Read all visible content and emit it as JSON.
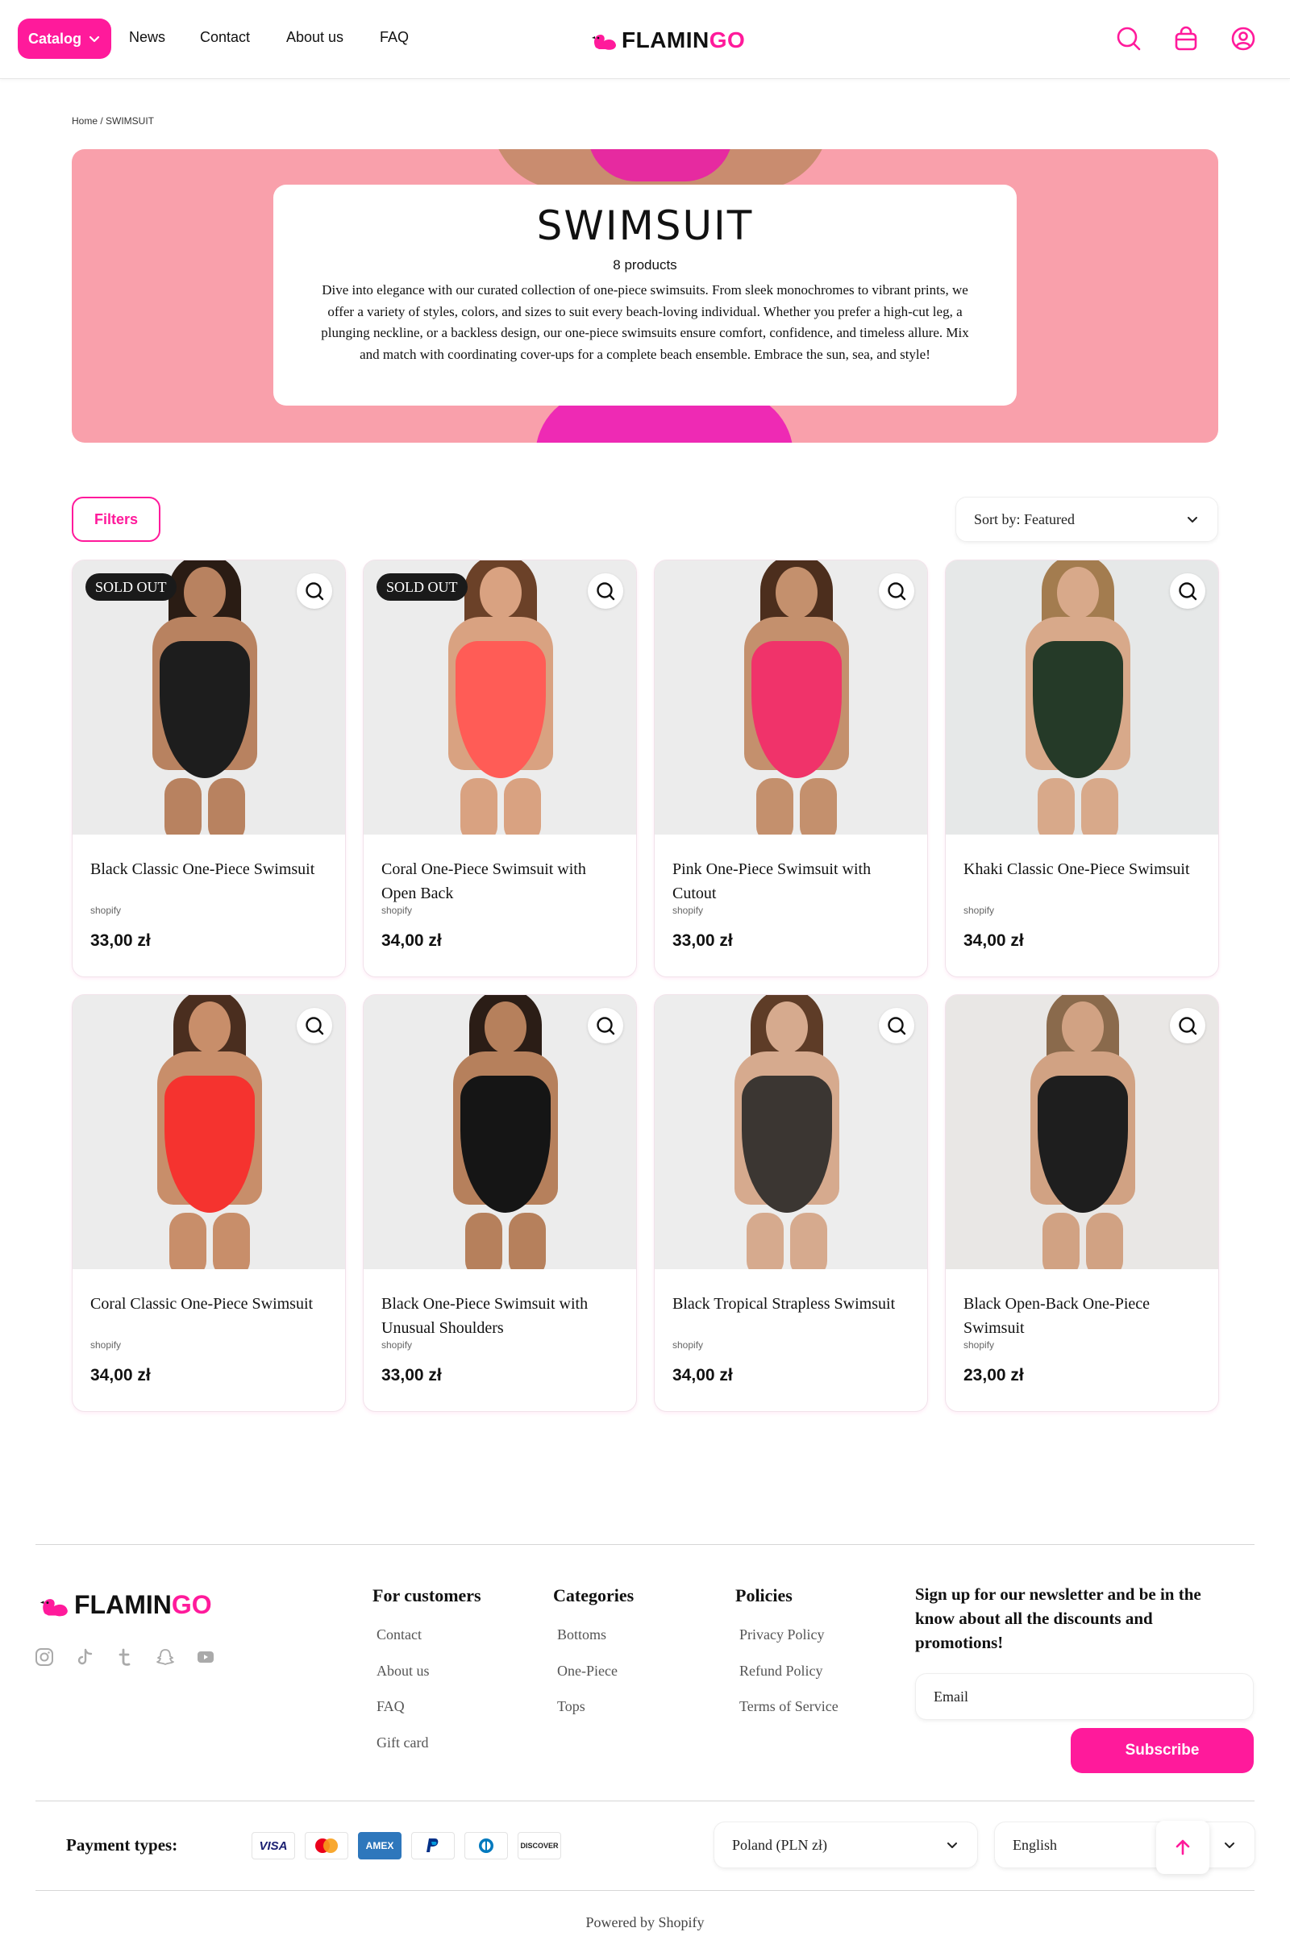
{
  "header": {
    "catalog_label": "Catalog",
    "nav": [
      "News",
      "Contact",
      "About us",
      "FAQ"
    ],
    "logo_part1": "FLAMIN",
    "logo_part2": "GO",
    "icons": [
      "search-icon",
      "bag-icon",
      "account-icon"
    ]
  },
  "colors": {
    "brand_pink": "#ff1a9b",
    "hero_bg": "#f9a0ab"
  },
  "breadcrumb": "Home / SWIMSUIT",
  "hero": {
    "title": "SWIMSUIT",
    "count": "8 products",
    "description": "Dive into elegance with our curated collection of one-piece swimsuits. From sleek monochromes to vibrant prints, we offer a variety of styles, colors, and sizes to suit every beach-loving individual. Whether you prefer a high-cut leg, a plunging neckline, or a backless design, our one-piece swimsuits ensure comfort, confidence, and timeless allure. Mix and match with coordinating cover-ups for a complete beach ensemble. Embrace the sun, sea, and style!"
  },
  "toolbar": {
    "filters_label": "Filters",
    "sort_label": "Sort by: Featured"
  },
  "products": [
    {
      "title": "Black Classic One-Piece Swimsuit",
      "vendor": "shopify",
      "price": "33,00 zł",
      "badge": "SOLD OUT",
      "suit": "#1d1d1d",
      "bg": "#ebebeb",
      "hair": "#2a1c14",
      "skin": "#b88260"
    },
    {
      "title": "Coral One-Piece Swimsuit with Open Back",
      "vendor": "shopify",
      "price": "34,00 zł",
      "badge": "SOLD OUT",
      "suit": "#ff5c56",
      "bg": "#ececec",
      "hair": "#6b4128",
      "skin": "#d9a281"
    },
    {
      "title": "Pink One-Piece Swimsuit with Cutout",
      "vendor": "shopify",
      "price": "33,00 zł",
      "badge": "",
      "suit": "#f0336a",
      "bg": "#ececec",
      "hair": "#4c2e1d",
      "skin": "#c4906d"
    },
    {
      "title": "Khaki Classic One-Piece Swimsuit",
      "vendor": "shopify",
      "price": "34,00 zł",
      "badge": "",
      "suit": "#253a28",
      "bg": "#e6e8e8",
      "hair": "#a37c4f",
      "skin": "#d8a98a"
    },
    {
      "title": "Coral Classic One-Piece Swimsuit",
      "vendor": "shopify",
      "price": "34,00 zł",
      "badge": "",
      "suit": "#f5332f",
      "bg": "#ececec",
      "hair": "#4a2e1f",
      "skin": "#c88e6a"
    },
    {
      "title": "Black One-Piece Swimsuit with Unusual Shoulders",
      "vendor": "shopify",
      "price": "33,00 zł",
      "badge": "",
      "suit": "#151515",
      "bg": "#ececec",
      "hair": "#2b1d16",
      "skin": "#b6805c"
    },
    {
      "title": "Black Tropical Strapless Swimsuit",
      "vendor": "shopify",
      "price": "34,00 zł",
      "badge": "",
      "suit": "#3b3632",
      "bg": "#ededed",
      "hair": "#5e3c27",
      "skin": "#d6aa8e"
    },
    {
      "title": "Black Open-Back One-Piece Swimsuit",
      "vendor": "shopify",
      "price": "23,00 zł",
      "badge": "",
      "suit": "#1e1e1e",
      "bg": "#e9e7e5",
      "hair": "#8a6a4c",
      "skin": "#d1a283"
    }
  ],
  "footer": {
    "logo_part1": "FLAMIN",
    "logo_part2": "GO",
    "social_icons": [
      "instagram-icon",
      "tiktok-icon",
      "tumblr-icon",
      "snapchat-icon",
      "youtube-icon"
    ],
    "columns": [
      {
        "title": "For customers",
        "links": [
          "Contact",
          "About us",
          "FAQ",
          "Gift card"
        ]
      },
      {
        "title": "Categories",
        "links": [
          "Bottoms",
          "One-Piece",
          "Tops"
        ]
      },
      {
        "title": "Policies",
        "links": [
          "Privacy Policy",
          "Refund Policy",
          "Terms of Service"
        ]
      }
    ],
    "newsletter_text": "Sign up for our newsletter and be in the know about all the discounts and promotions!",
    "email_placeholder": "Email",
    "subscribe_label": "Subscribe",
    "payment_label": "Payment types:",
    "payments": [
      "VISA",
      "Mastercard",
      "AMEX",
      "PayPal",
      "Diners",
      "DISCOVER"
    ],
    "currency": "Poland (PLN zł)",
    "language": "English",
    "powered": "Powered by Shopify"
  }
}
